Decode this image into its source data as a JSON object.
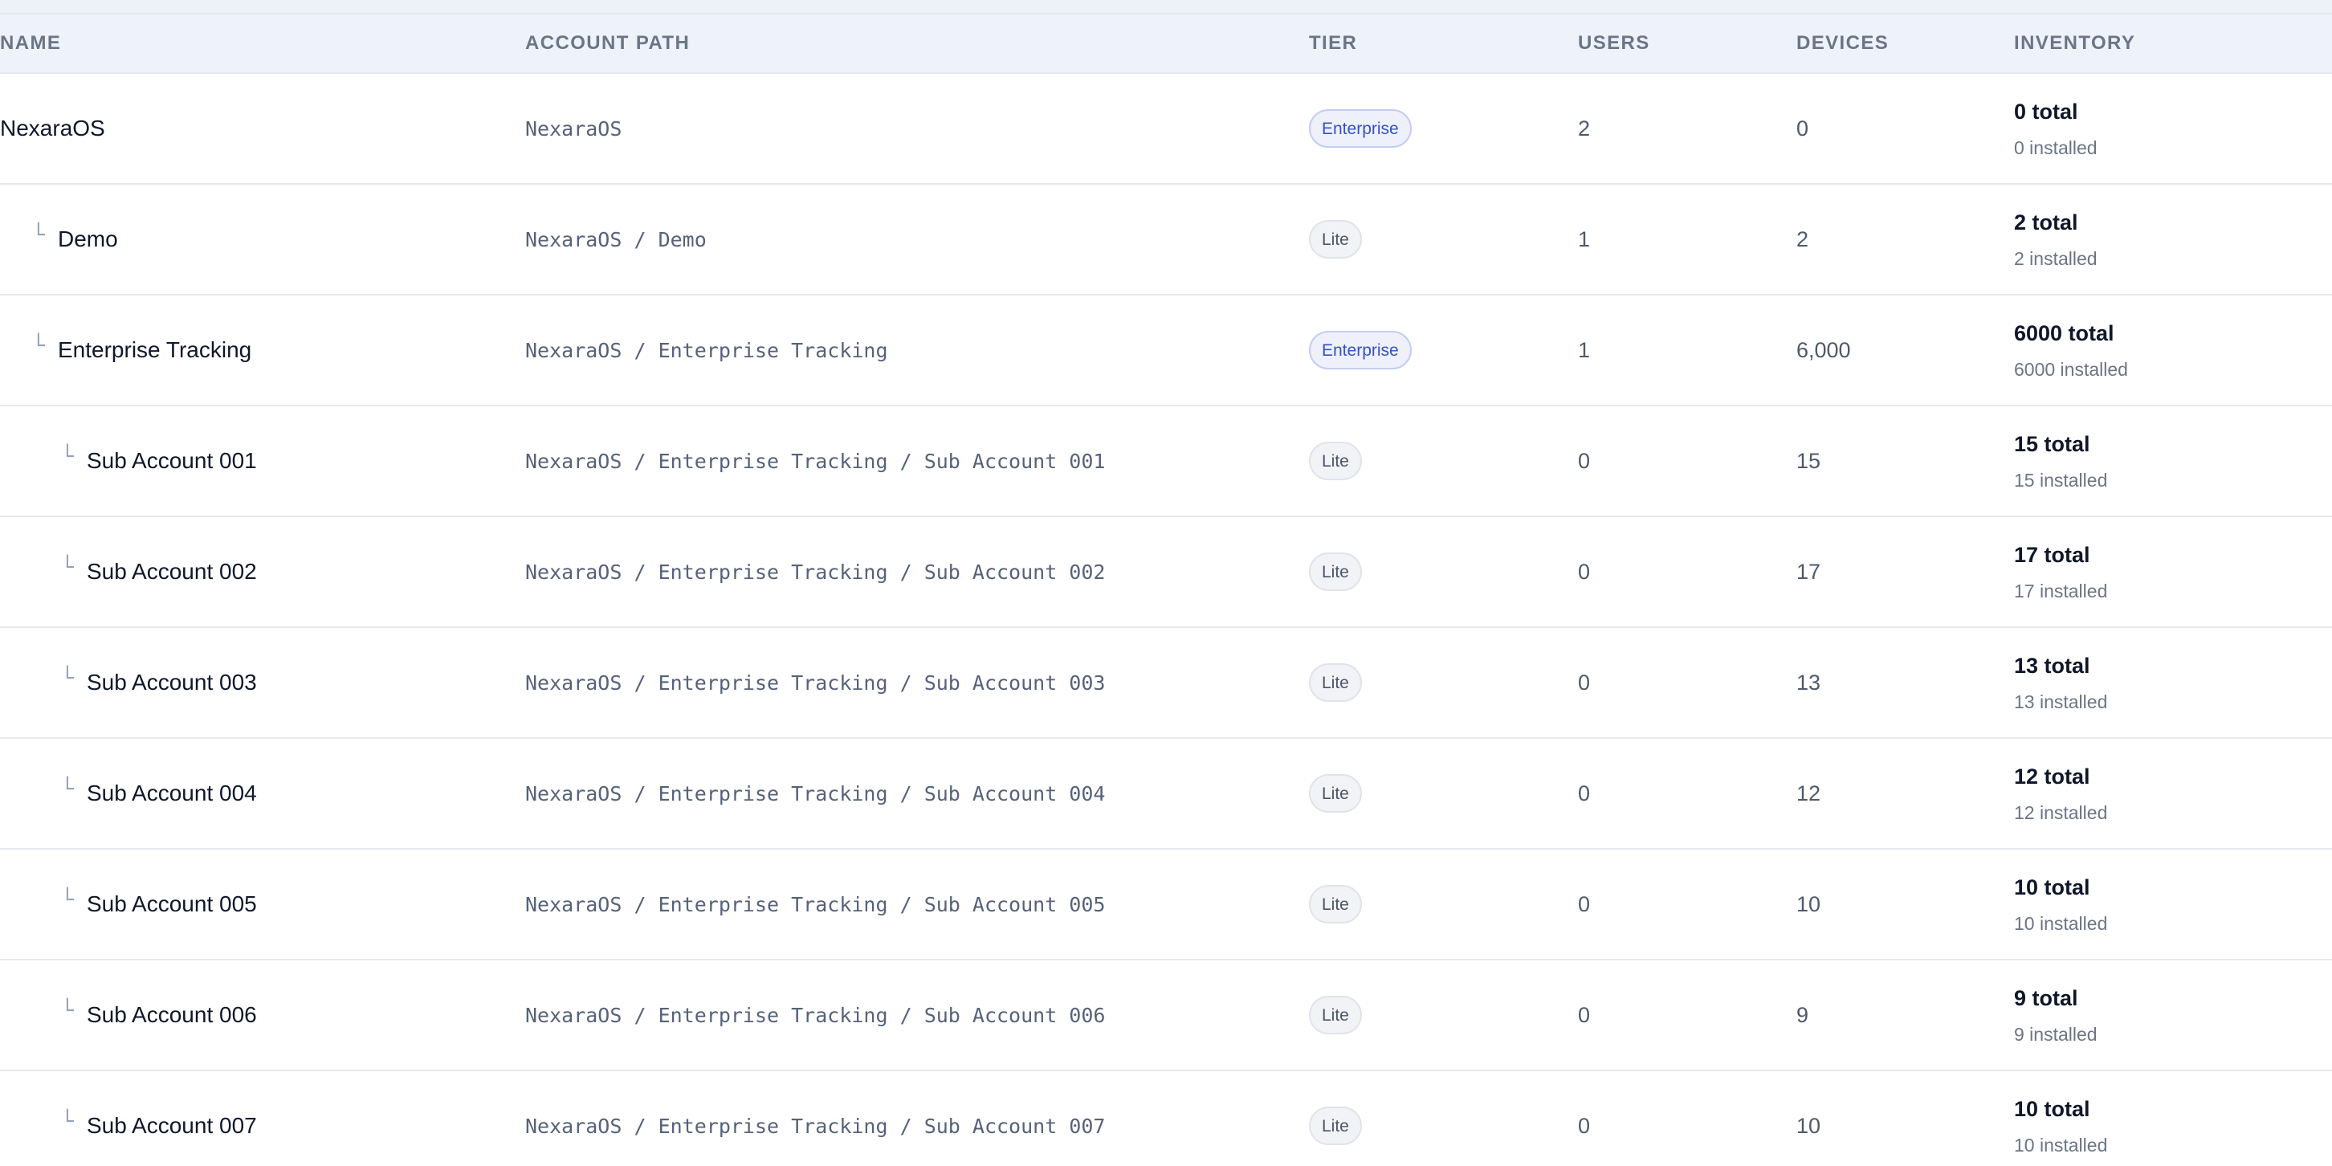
{
  "table": {
    "headers": {
      "name": "NAME",
      "path": "ACCOUNT PATH",
      "tier": "TIER",
      "users": "USERS",
      "devices": "DEVICES",
      "inventory": "INVENTORY"
    },
    "rows": [
      {
        "level": 0,
        "name": "NexaraOS",
        "path": "NexaraOS",
        "tier": "Enterprise",
        "users": "2",
        "devices": "0",
        "inv_total": "0 total",
        "inv_installed": "0 installed"
      },
      {
        "level": 1,
        "name": "Demo",
        "path": "NexaraOS / Demo",
        "tier": "Lite",
        "users": "1",
        "devices": "2",
        "inv_total": "2 total",
        "inv_installed": "2 installed"
      },
      {
        "level": 1,
        "name": "Enterprise Tracking",
        "path": "NexaraOS / Enterprise Tracking",
        "tier": "Enterprise",
        "users": "1",
        "devices": "6,000",
        "inv_total": "6000 total",
        "inv_installed": "6000 installed"
      },
      {
        "level": 2,
        "name": "Sub Account 001",
        "path": "NexaraOS / Enterprise Tracking / Sub Account 001",
        "tier": "Lite",
        "users": "0",
        "devices": "15",
        "inv_total": "15 total",
        "inv_installed": "15 installed"
      },
      {
        "level": 2,
        "name": "Sub Account 002",
        "path": "NexaraOS / Enterprise Tracking / Sub Account 002",
        "tier": "Lite",
        "users": "0",
        "devices": "17",
        "inv_total": "17 total",
        "inv_installed": "17 installed"
      },
      {
        "level": 2,
        "name": "Sub Account 003",
        "path": "NexaraOS / Enterprise Tracking / Sub Account 003",
        "tier": "Lite",
        "users": "0",
        "devices": "13",
        "inv_total": "13 total",
        "inv_installed": "13 installed"
      },
      {
        "level": 2,
        "name": "Sub Account 004",
        "path": "NexaraOS / Enterprise Tracking / Sub Account 004",
        "tier": "Lite",
        "users": "0",
        "devices": "12",
        "inv_total": "12 total",
        "inv_installed": "12 installed"
      },
      {
        "level": 2,
        "name": "Sub Account 005",
        "path": "NexaraOS / Enterprise Tracking / Sub Account 005",
        "tier": "Lite",
        "users": "0",
        "devices": "10",
        "inv_total": "10 total",
        "inv_installed": "10 installed"
      },
      {
        "level": 2,
        "name": "Sub Account 006",
        "path": "NexaraOS / Enterprise Tracking / Sub Account 006",
        "tier": "Lite",
        "users": "0",
        "devices": "9",
        "inv_total": "9 total",
        "inv_installed": "9 installed"
      },
      {
        "level": 2,
        "name": "Sub Account 007",
        "path": "NexaraOS / Enterprise Tracking / Sub Account 007",
        "tier": "Lite",
        "users": "0",
        "devices": "10",
        "inv_total": "10 total",
        "inv_installed": "10 installed"
      }
    ]
  },
  "colors": {
    "header_bg": "#eef2fb",
    "enterprise_badge": "#3451c8",
    "lite_badge": "#4a5568"
  }
}
